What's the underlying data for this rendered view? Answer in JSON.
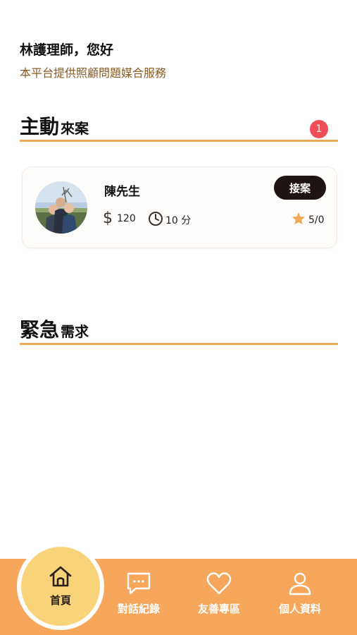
{
  "header": {
    "greeting": "林護理師，您好",
    "subtitle": "本平台提供照顧問題媒合服務"
  },
  "active_cases": {
    "title_big": "主動",
    "title_small": "來案",
    "badge_count": "1",
    "cards": [
      {
        "name": "陳先生",
        "accept_label": "接案",
        "price_icon": "dollar-icon",
        "price": "120",
        "time_icon": "clock-icon",
        "time": "10 分",
        "rating_icon": "star-icon",
        "rating": "5/0"
      }
    ]
  },
  "urgent": {
    "title_big": "緊急",
    "title_small": "需求"
  },
  "bottom_nav": {
    "items": [
      {
        "label": "首頁",
        "icon": "home-icon",
        "active": true
      },
      {
        "label": "對話紀錄",
        "icon": "chat-icon"
      },
      {
        "label": "友善專區",
        "icon": "heart-icon"
      },
      {
        "label": "個人資料",
        "icon": "user-icon"
      }
    ]
  },
  "colors": {
    "accent": "#f2a957",
    "nav_bar": "#f7a75c",
    "home_circle": "#f9d37a",
    "badge": "#ef4e57",
    "button": "#1e1412",
    "star": "#f2a957"
  }
}
